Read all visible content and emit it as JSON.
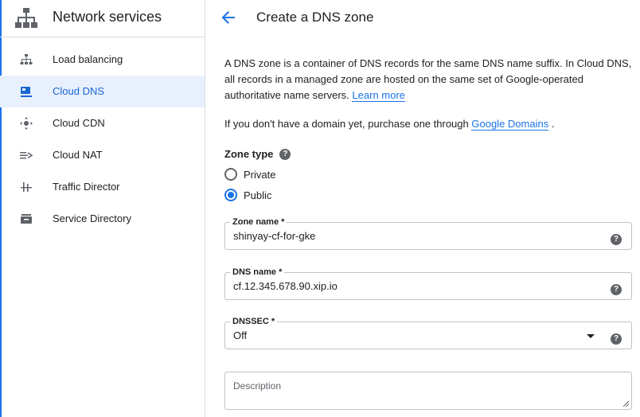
{
  "sidebar": {
    "title": "Network services",
    "items": [
      {
        "label": "Load balancing",
        "icon": "load-balancing-icon"
      },
      {
        "label": "Cloud DNS",
        "icon": "cloud-dns-icon",
        "active": true
      },
      {
        "label": "Cloud CDN",
        "icon": "cloud-cdn-icon"
      },
      {
        "label": "Cloud NAT",
        "icon": "cloud-nat-icon"
      },
      {
        "label": "Traffic Director",
        "icon": "traffic-director-icon"
      },
      {
        "label": "Service Directory",
        "icon": "service-directory-icon"
      }
    ]
  },
  "header": {
    "title": "Create a DNS zone"
  },
  "intro": {
    "text": "A DNS zone is a container of DNS records for the same DNS name suffix. In Cloud DNS, all records in a managed zone are hosted on the same set of Google-operated authoritative name servers.",
    "learn_more": "Learn more"
  },
  "domain": {
    "prefix": "If you don't have a domain yet, purchase one through",
    "link": "Google Domains",
    "suffix": "."
  },
  "zone_type": {
    "label": "Zone type",
    "options": [
      {
        "label": "Private",
        "checked": false
      },
      {
        "label": "Public",
        "checked": true
      }
    ]
  },
  "fields": {
    "zone_name": {
      "label": "Zone name *",
      "value": "shinyay-cf-for-gke"
    },
    "dns_name": {
      "label": "DNS name *",
      "value": "cf.12.345.678.90.xip.io"
    },
    "dnssec": {
      "label": "DNSSEC *",
      "value": "Off"
    },
    "description": {
      "placeholder": "Description"
    }
  },
  "colors": {
    "accent": "#1a73e8",
    "active_bg": "#e8f0fe",
    "border": "#dadce0",
    "icon_gray": "#5f6368"
  }
}
